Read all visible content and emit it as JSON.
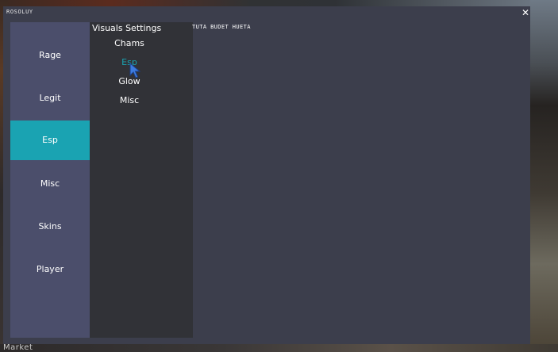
{
  "background": {
    "bottom_text": "Market"
  },
  "window": {
    "title": "ROSOLUY",
    "close_glyph": "✕",
    "content_text": "TUTA BUDET HUETA"
  },
  "sidebar": {
    "items": [
      {
        "label": "Rage",
        "active": false
      },
      {
        "label": "Legit",
        "active": false
      },
      {
        "label": "Esp",
        "active": true
      },
      {
        "label": "Misc",
        "active": false
      },
      {
        "label": "Skins",
        "active": false
      },
      {
        "label": "Player",
        "active": false
      }
    ]
  },
  "subpanel": {
    "title": "Visuals Settings",
    "items": [
      {
        "label": "Chams",
        "active": false
      },
      {
        "label": "Esp",
        "active": true
      },
      {
        "label": "Glow",
        "active": false
      },
      {
        "label": "Misc",
        "active": false
      }
    ]
  },
  "colors": {
    "accent": "#1aa3b2",
    "window_bg": "#3c3e4c",
    "sidebar_bg": "#4b4e6b",
    "subpanel_bg": "#313237",
    "cursor": "#3d7be0"
  },
  "icons": {
    "close": "close-icon",
    "cursor": "mouse-pointer-icon"
  }
}
